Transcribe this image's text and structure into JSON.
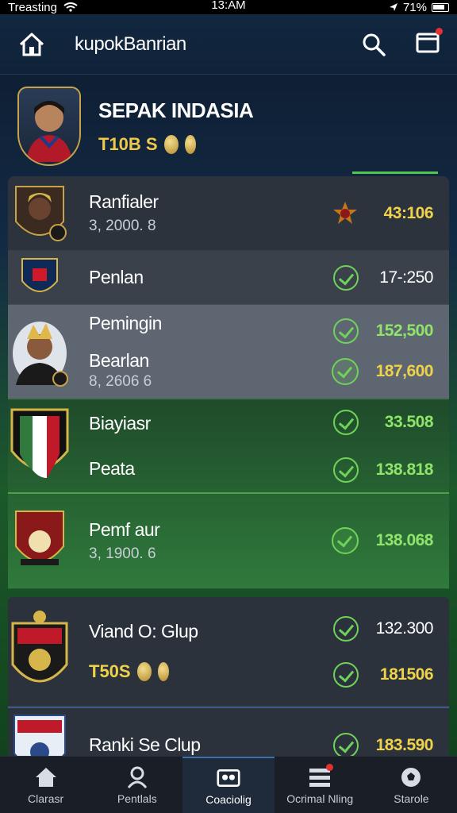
{
  "status_bar": {
    "carrier": "Treasting",
    "time": "13:AM",
    "battery": "71%"
  },
  "header": {
    "title": "kupokBanrian"
  },
  "profile": {
    "name": "SEPAK INDASIA",
    "subtitle": "T10B S"
  },
  "list": [
    {
      "name": "Ranfialer",
      "sub": "3, 2000.  8",
      "values": [
        "43:106"
      ]
    },
    {
      "name": "Penlan",
      "sub": "",
      "values": [
        "17-:250"
      ]
    },
    {
      "name": "Pemingin",
      "name2": "Bearlan",
      "sub": "8, 2606  6",
      "values": [
        "152,500",
        "187,600"
      ]
    },
    {
      "name": "Biayiasr",
      "name2": "Peata",
      "values": [
        "33.508",
        "138.818"
      ],
      "name3": "Pemf aur",
      "sub3": "3, 1900.  6",
      "value3": "138.068"
    },
    {
      "name": "Viand O: Glup",
      "sub": "T50S",
      "values": [
        "132.300",
        "181506"
      ]
    },
    {
      "name": "Ranki Se Clup",
      "values": [
        "183.590"
      ]
    }
  ],
  "bottom_nav": [
    {
      "label": "Clarasr",
      "icon": "home-icon"
    },
    {
      "label": "Pentlals",
      "icon": "person-icon"
    },
    {
      "label": "Coaciolig",
      "icon": "team-icon"
    },
    {
      "label": "Ocrimal Nling",
      "icon": "list-icon"
    },
    {
      "label": "Starole",
      "icon": "ball-icon"
    }
  ],
  "colors": {
    "accent_green": "#6fd25a",
    "gold": "#f0d24a",
    "header": "#122840"
  }
}
